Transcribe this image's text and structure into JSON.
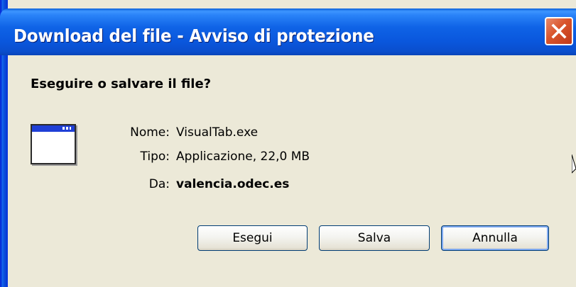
{
  "dialog": {
    "title": "Download del file - Avviso di protezione",
    "question": "Eseguire o salvare il file?"
  },
  "file": {
    "name_label": "Nome:",
    "name_value": "VisualTab.exe",
    "type_label": "Tipo:",
    "type_value": "Applicazione, 22,0 MB",
    "from_label": "Da:",
    "from_value": "valencia.odec.es"
  },
  "buttons": {
    "run": "Esegui",
    "save": "Salva",
    "cancel": "Annulla"
  },
  "colors": {
    "titlebar": "#0a57dd",
    "close": "#d9542b",
    "dialog_bg": "#ece9d8"
  }
}
